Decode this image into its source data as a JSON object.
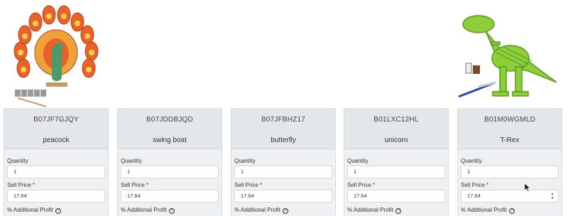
{
  "products": [
    {
      "asin": "B07JF7GJQY",
      "name": "peacock",
      "quantity": "1",
      "sell_price": "17.64"
    },
    {
      "asin": "B07JDDBJQD",
      "name": "swing boat",
      "quantity": "1",
      "sell_price": "17.64"
    },
    {
      "asin": "B07JFBHZ17",
      "name": "butterfly",
      "quantity": "1",
      "sell_price": "17.64"
    },
    {
      "asin": "B01LXC12HL",
      "name": "unicorn",
      "quantity": "1",
      "sell_price": "17.64"
    },
    {
      "asin": "B01M0WGMLD",
      "name": "T-Rex",
      "quantity": "1",
      "sell_price": "17.64"
    }
  ],
  "labels": {
    "quantity": "Quantity",
    "sell_price": "Sell Price *",
    "additional_profit": "% Additional Profit"
  },
  "icons": {
    "help": "question-circle-icon",
    "stepper": "number-stepper-icon",
    "cursor": "mouse-pointer-icon"
  },
  "colors": {
    "card_bg": "#eef0f2",
    "header_bg": "#e4e7ea",
    "peacock_orange": "#e8622a",
    "trex_green": "#8ccf3a"
  }
}
